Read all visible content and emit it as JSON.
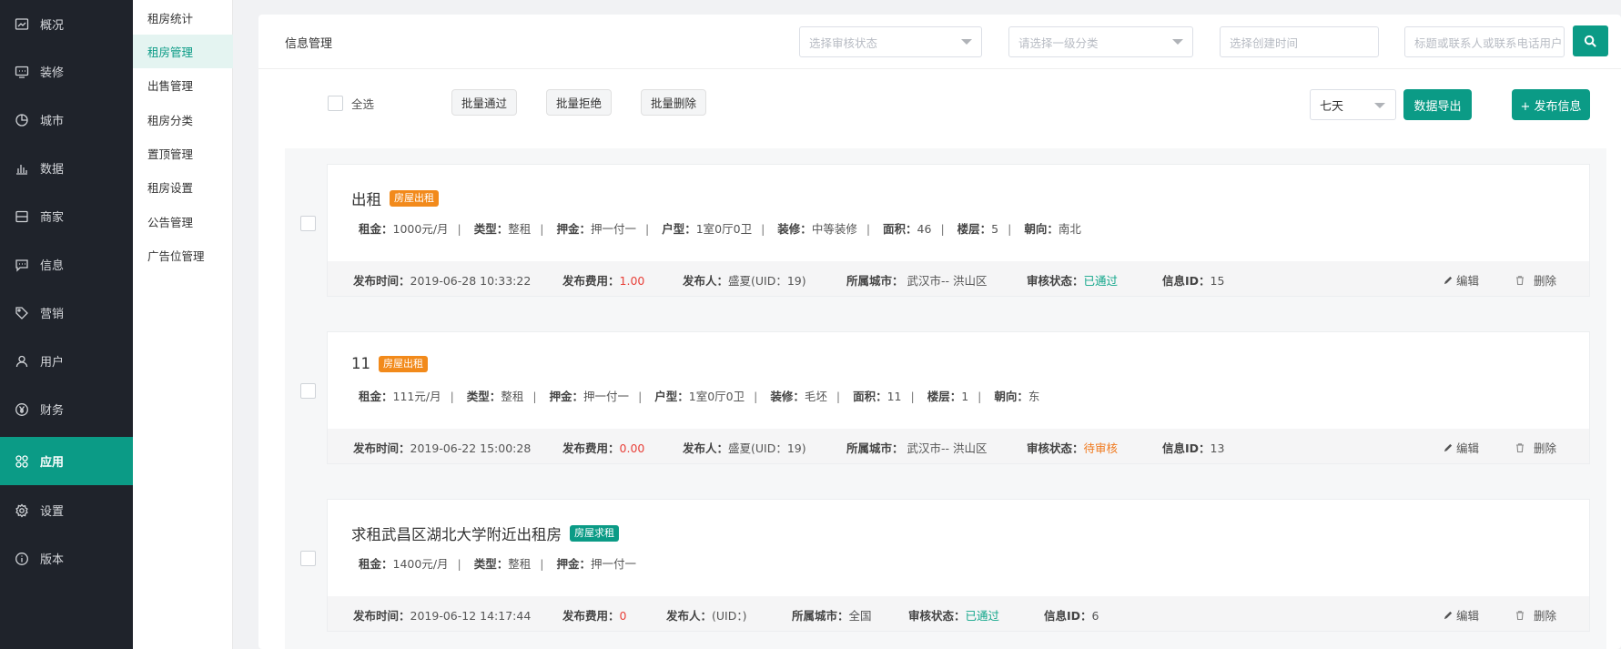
{
  "nav": [
    {
      "label": "概况",
      "icon": "overview-icon"
    },
    {
      "label": "装修",
      "icon": "decorate-icon"
    },
    {
      "label": "城市",
      "icon": "city-icon"
    },
    {
      "label": "数据",
      "icon": "chart-bars-icon"
    },
    {
      "label": "商家",
      "icon": "store-icon"
    },
    {
      "label": "信息",
      "icon": "message-icon"
    },
    {
      "label": "营销",
      "icon": "tag-icon"
    },
    {
      "label": "用户",
      "icon": "user-icon"
    },
    {
      "label": "财务",
      "icon": "yen-icon"
    },
    {
      "label": "应用",
      "icon": "apps-icon"
    },
    {
      "label": "设置",
      "icon": "gear-icon"
    },
    {
      "label": "版本",
      "icon": "info-icon"
    }
  ],
  "subnav": [
    "租房统计",
    "租房管理",
    "出售管理",
    "租房分类",
    "置顶管理",
    "租房设置",
    "公告管理",
    "广告位管理"
  ],
  "header": {
    "title": "信息管理",
    "audit_placeholder": "选择审核状态",
    "category_placeholder": "请选择一级分类",
    "time_placeholder": "选择创建时间",
    "keyword_placeholder": "标题或联系人或联系电话用户"
  },
  "actions": {
    "select_all": "全选",
    "batch_pass": "批量通过",
    "batch_reject": "批量拒绝",
    "batch_delete": "批量删除",
    "period": "七天",
    "export": "数据导出",
    "publish": "+ 发布信息"
  },
  "labels": {
    "rent": "租金：",
    "type": "类型：",
    "deposit": "押金：",
    "layout": "户型：",
    "decoration": "装修：",
    "area": "面积：",
    "floor": "楼层：",
    "facing": "朝向：",
    "publish_time": "发布时间：",
    "publish_fee": "发布费用：",
    "publisher": "发布人：",
    "city": "所属城市：",
    "audit": "审核状态：",
    "info_id": "信息ID：",
    "edit": "编辑",
    "delete": "删除",
    "sep": "|"
  },
  "listings": [
    {
      "title": "出租",
      "badge": "房屋出租",
      "rent": "1000元/月",
      "type": "整租",
      "deposit": "押一付一",
      "layout": "1室0厅0卫",
      "decoration": "中等装修",
      "area": "46",
      "floor": "5",
      "facing": "南北",
      "publish_time": "2019-06-28 10:33:22",
      "fee": "1.00",
      "publisher": "盛夏(UID：19)",
      "city": " 武汉市-- 洪山区",
      "audit": "已通过",
      "id": "15"
    },
    {
      "title": "11",
      "badge": "房屋出租",
      "rent": "111元/月",
      "type": "整租",
      "deposit": "押一付一",
      "layout": "1室0厅0卫",
      "decoration": "毛坯",
      "area": "11",
      "floor": "1",
      "facing": "东",
      "publish_time": "2019-06-22 15:00:28",
      "fee": "0.00",
      "publisher": "盛夏(UID：19)",
      "city": " 武汉市-- 洪山区",
      "audit": "待审核",
      "id": "13"
    },
    {
      "title": "求租武昌区湖北大学附近出租房",
      "badge": "房屋求租",
      "rent": "1400元/月",
      "type": "整租",
      "deposit": "押一付一",
      "publish_time": "2019-06-12 14:17:44",
      "fee": "0",
      "publisher": "(UID：)",
      "city": "全国",
      "audit": "已通过",
      "id": "6"
    }
  ]
}
